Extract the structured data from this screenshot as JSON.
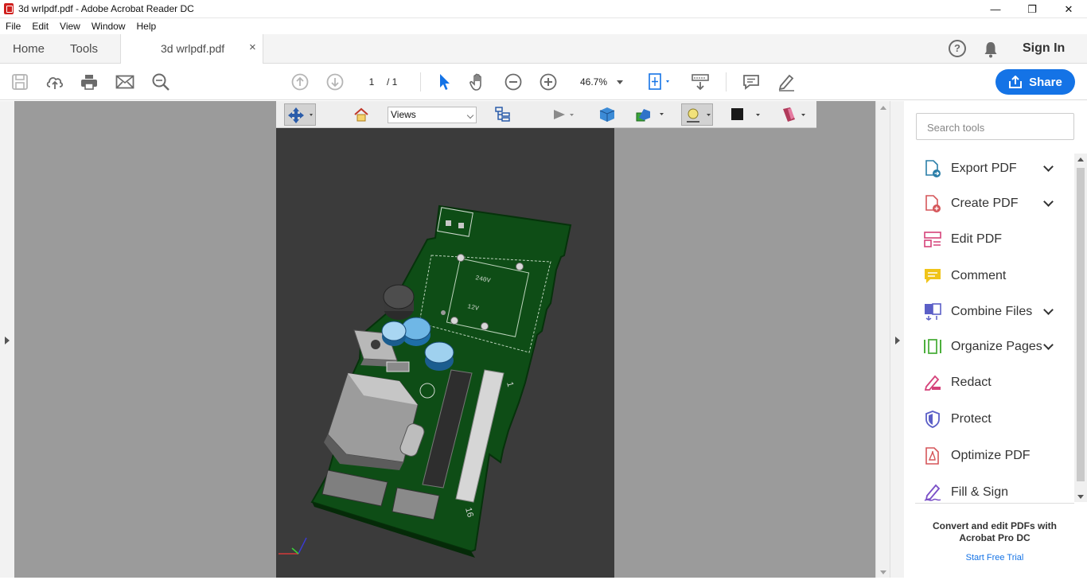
{
  "window": {
    "title": "3d wrlpdf.pdf - Adobe Acrobat Reader DC",
    "minimize": "—",
    "restore": "❐",
    "close": "✕"
  },
  "menu": [
    "File",
    "Edit",
    "View",
    "Window",
    "Help"
  ],
  "tabs": {
    "home": "Home",
    "tools": "Tools",
    "document": "3d wrlpdf.pdf",
    "close": "×"
  },
  "header": {
    "help": "?",
    "sign_in": "Sign In"
  },
  "toolbar": {
    "page_current": "1",
    "page_total": "/ 1",
    "zoom": "46.7%",
    "share_label": "Share"
  },
  "toolbar3d": {
    "views_value": "Views"
  },
  "pcb_labels": {
    "label_240v": "240V",
    "label_12v": "12V",
    "pin_1": "1",
    "pin_16": "16"
  },
  "right_pane": {
    "search_placeholder": "Search tools",
    "tools": [
      {
        "label": "Export PDF",
        "icon": "export-pdf-icon",
        "expandable": true
      },
      {
        "label": "Create PDF",
        "icon": "create-pdf-icon",
        "expandable": true
      },
      {
        "label": "Edit PDF",
        "icon": "edit-pdf-icon",
        "expandable": false
      },
      {
        "label": "Comment",
        "icon": "comment-icon",
        "expandable": false
      },
      {
        "label": "Combine Files",
        "icon": "combine-files-icon",
        "expandable": true
      },
      {
        "label": "Organize Pages",
        "icon": "organize-pages-icon",
        "expandable": true
      },
      {
        "label": "Redact",
        "icon": "redact-icon",
        "expandable": false
      },
      {
        "label": "Protect",
        "icon": "protect-icon",
        "expandable": false
      },
      {
        "label": "Optimize PDF",
        "icon": "optimize-pdf-icon",
        "expandable": false
      },
      {
        "label": "Fill & Sign",
        "icon": "fill-sign-icon",
        "expandable": false
      }
    ],
    "promo_title": "Convert and edit PDFs with Acrobat Pro DC",
    "promo_link": "Start Free Trial"
  },
  "colors": {
    "accent": "#1473e6",
    "pcb_green": "#0d4a12",
    "viewport_bg": "#3b3b3b",
    "doc_bg": "#9b9b9b"
  }
}
